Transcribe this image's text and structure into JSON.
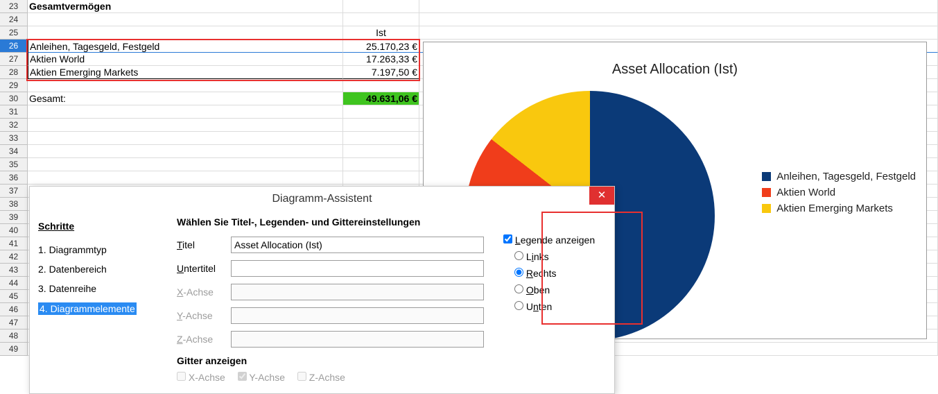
{
  "rows": {
    "r23": {
      "a": "Gesamtvermögen"
    },
    "r25": {
      "b_header": "Ist"
    },
    "r26": {
      "a": "Anleihen, Tagesgeld, Festgeld",
      "b": "25.170,23 €"
    },
    "r27": {
      "a": "Aktien World",
      "b": "17.263,33 €"
    },
    "r28": {
      "a": "Aktien Emerging Markets",
      "b": "7.197,50 €"
    },
    "r30": {
      "a": "Gesamt:",
      "b": "49.631,06 €"
    }
  },
  "row_numbers": [
    "23",
    "24",
    "25",
    "26",
    "27",
    "28",
    "29",
    "30",
    "31",
    "32",
    "33",
    "34",
    "35",
    "36",
    "37",
    "38",
    "39",
    "40",
    "41",
    "42",
    "43",
    "44",
    "45",
    "46",
    "47",
    "48",
    "49"
  ],
  "chart": {
    "title": "Asset Allocation (Ist)",
    "legend": [
      {
        "label": "Anleihen, Tagesgeld, Festgeld",
        "color": "#0b3a78"
      },
      {
        "label": "Aktien World",
        "color": "#f03d1b"
      },
      {
        "label": "Aktien Emerging Markets",
        "color": "#f9c80e"
      }
    ]
  },
  "chart_data": {
    "type": "pie",
    "title": "Asset Allocation (Ist)",
    "categories": [
      "Anleihen, Tagesgeld, Festgeld",
      "Aktien World",
      "Aktien Emerging Markets"
    ],
    "values": [
      25170.23,
      17263.33,
      7197.5
    ],
    "series": [
      {
        "name": "Ist",
        "values": [
          25170.23,
          17263.33,
          7197.5
        ]
      }
    ],
    "colors": [
      "#0b3a78",
      "#f03d1b",
      "#f9c80e"
    ],
    "legend_position": "right"
  },
  "dialog": {
    "title": "Diagramm-Assistent",
    "steps_header": "Schritte",
    "steps": [
      "1. Diagrammtyp",
      "2. Datenbereich",
      "3. Datenreihe",
      "4. Diagrammelemente"
    ],
    "form_header": "Wählen Sie Titel-, Legenden- und Gittereinstellungen",
    "labels": {
      "title": "Titel",
      "subtitle": "Untertitel",
      "xaxis": "X-Achse",
      "yaxis": "Y-Achse",
      "zaxis": "Z-Achse"
    },
    "title_value": "Asset Allocation (Ist)",
    "grid_header": "Gitter anzeigen",
    "grid_x": "X-Achse",
    "grid_y": "Y-Achse",
    "grid_z": "Z-Achse",
    "legend_show": "Legende anzeigen",
    "legend_left": "Links",
    "legend_right": "Rechts",
    "legend_top": "Oben",
    "legend_bottom": "Unten"
  }
}
